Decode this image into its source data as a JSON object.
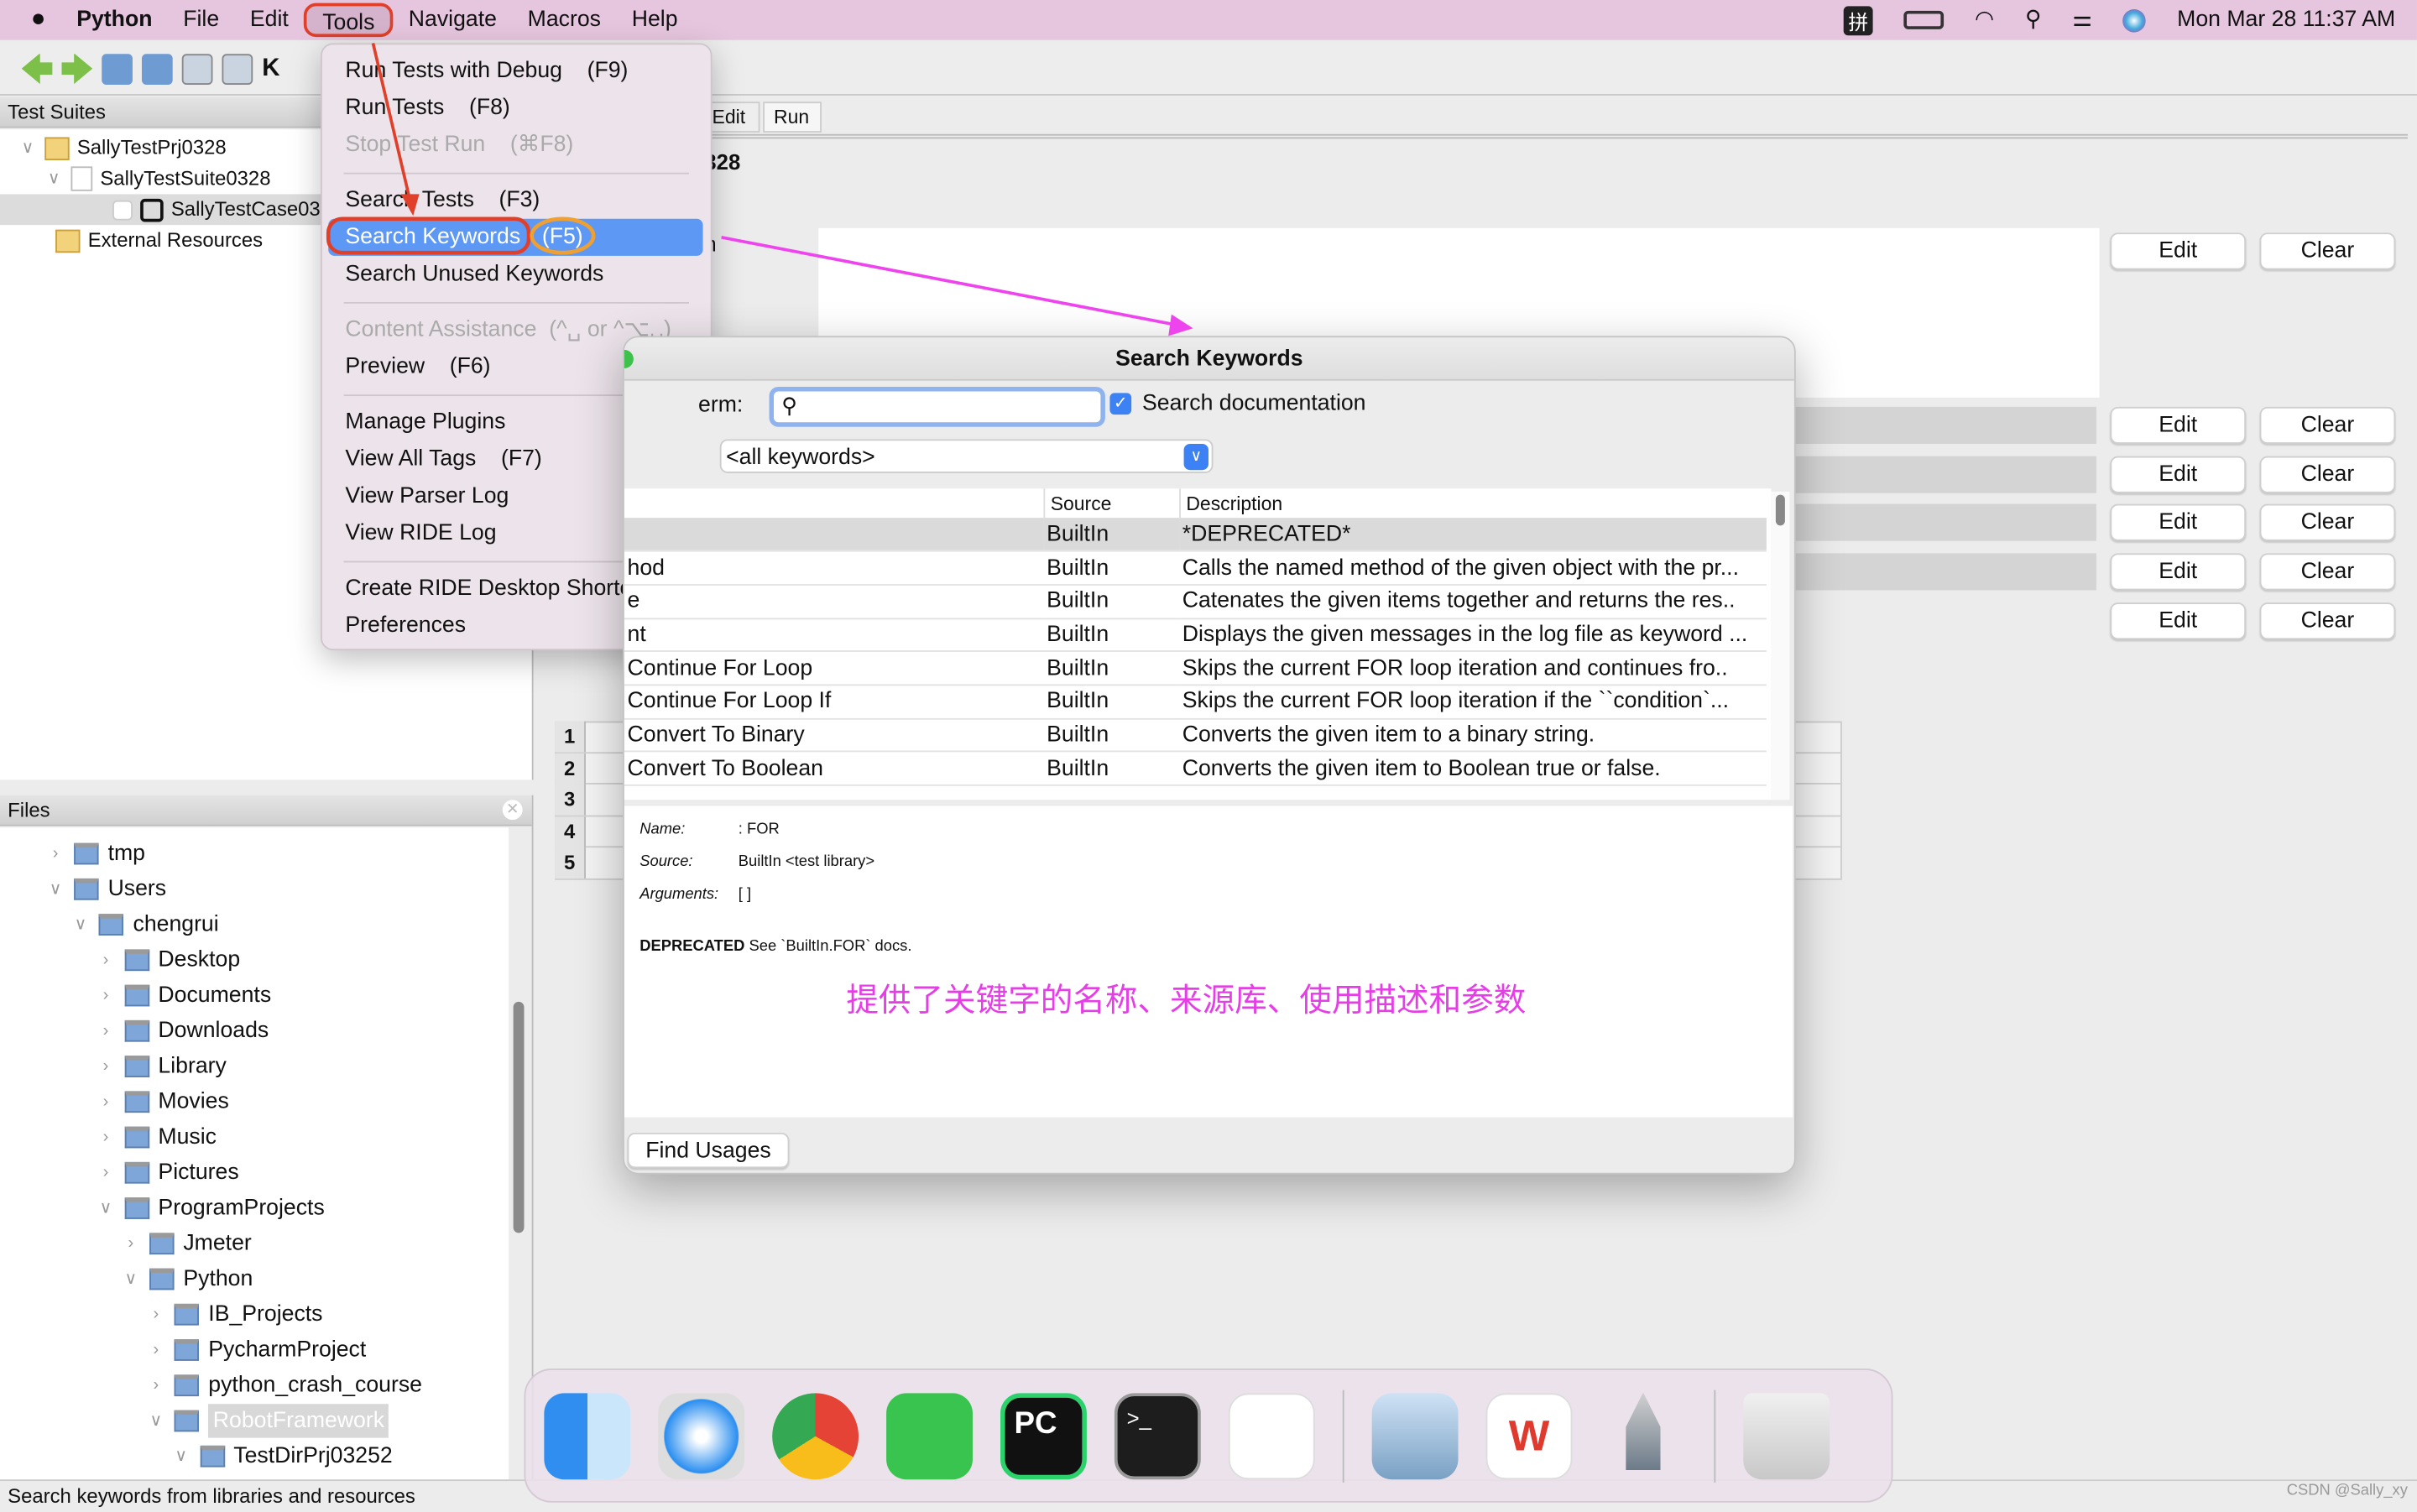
{
  "menubar": {
    "app": "Python",
    "items": [
      "File",
      "Edit",
      "Tools",
      "Navigate",
      "Macros",
      "Help"
    ],
    "input_method": "拼",
    "datetime": "Mon Mar 28  11:37 AM"
  },
  "tools_menu": {
    "items": [
      {
        "label": "Run Tests with Debug    (F9)",
        "disabled": false
      },
      {
        "label": "Run Tests    (F8)",
        "disabled": false
      },
      {
        "label": "Stop Test Run    (⌘F8)",
        "disabled": true
      },
      {
        "sep": true
      },
      {
        "label": "Search Tests    (F3)",
        "disabled": false
      },
      {
        "label": "Search Keywords",
        "shortcut": "(F5)",
        "highlighted": true
      },
      {
        "label": "Search Unused Keywords",
        "disabled": false
      },
      {
        "sep": true
      },
      {
        "label": "Content Assistance  (^␣ or ^⌥␣)",
        "disabled": true
      },
      {
        "label": "Preview    (F6)",
        "disabled": false
      },
      {
        "sep": true
      },
      {
        "label": "Manage Plugins",
        "disabled": false
      },
      {
        "label": "View All Tags    (F7)",
        "disabled": false
      },
      {
        "label": "View Parser Log",
        "disabled": false
      },
      {
        "label": "View RIDE Log",
        "disabled": false
      },
      {
        "sep": true
      },
      {
        "label": "Create RIDE Desktop Shortcut",
        "disabled": false
      },
      {
        "label": "Preferences",
        "disabled": false
      }
    ]
  },
  "test_suites": {
    "title": "Test Suites",
    "items": [
      "SallyTestPrj0328",
      "SallyTestSuite0328",
      "SallyTestCase03",
      "External Resources"
    ]
  },
  "files": {
    "title": "Files",
    "items": [
      {
        "label": "tmp",
        "level": 0,
        "open": false
      },
      {
        "label": "Users",
        "level": 0,
        "open": true
      },
      {
        "label": "chengrui",
        "level": 1,
        "open": true
      },
      {
        "label": "Desktop",
        "level": 2,
        "open": false
      },
      {
        "label": "Documents",
        "level": 2,
        "open": false
      },
      {
        "label": "Downloads",
        "level": 2,
        "open": false
      },
      {
        "label": "Library",
        "level": 2,
        "open": false
      },
      {
        "label": "Movies",
        "level": 2,
        "open": false
      },
      {
        "label": "Music",
        "level": 2,
        "open": false
      },
      {
        "label": "Pictures",
        "level": 2,
        "open": false
      },
      {
        "label": "ProgramProjects",
        "level": 2,
        "open": true
      },
      {
        "label": "Jmeter",
        "level": 3,
        "open": false
      },
      {
        "label": "Python",
        "level": 3,
        "open": true
      },
      {
        "label": "IB_Projects",
        "level": 4,
        "open": false
      },
      {
        "label": "PycharmProject",
        "level": 4,
        "open": false
      },
      {
        "label": "python_crash_course",
        "level": 4,
        "open": false
      },
      {
        "label": "RobotFramework",
        "level": 4,
        "open": true,
        "selected": true
      },
      {
        "label": "TestDirPrj03252",
        "level": 5,
        "open": true
      }
    ]
  },
  "editor": {
    "tabs": [
      "Edit",
      "Run"
    ],
    "title_fragment": "328",
    "label_fragment": "n",
    "edit_label": "Edit",
    "clear_label": "Clear",
    "grid_rows": [
      "1",
      "2",
      "3",
      "4",
      "5"
    ]
  },
  "dialog": {
    "title": "Search Keywords",
    "term_label": "erm:",
    "search_value": "",
    "search_doc_label": "Search documentation",
    "search_doc_checked": true,
    "source_select": "<all keywords>",
    "columns": [
      "",
      "Source",
      "Description"
    ],
    "rows": [
      [
        "",
        "BuiltIn",
        "*DEPRECATED*"
      ],
      [
        "hod",
        "BuiltIn",
        "Calls the named method of the given object with the pr..."
      ],
      [
        "e",
        "BuiltIn",
        "Catenates the given items together and returns the res.."
      ],
      [
        "nt",
        "BuiltIn",
        "Displays the given messages in the log file as keyword ..."
      ],
      [
        "Continue For Loop",
        "BuiltIn",
        "Skips the current FOR loop iteration and continues fro.."
      ],
      [
        "Continue For Loop If",
        "BuiltIn",
        "Skips the current FOR loop iteration if the ``condition`..."
      ],
      [
        "Convert To Binary",
        "BuiltIn",
        "Converts the given item to a binary string."
      ],
      [
        "Convert To Boolean",
        "BuiltIn",
        "Converts the given item to Boolean true or false."
      ]
    ],
    "details": {
      "name_label": "Name:",
      "name": ": FOR",
      "source_label": "Source:",
      "source": "BuiltIn <test library>",
      "args_label": "Arguments:",
      "args": "[ ]",
      "doc_bold": "DEPRECATED",
      "doc": " See `BuiltIn.FOR` docs."
    },
    "annotation": "提供了关键字的名称、来源库、使用描述和参数",
    "find_usages": "Find Usages"
  },
  "status_bar": "Search keywords from libraries and resources",
  "watermark": "CSDN @Sally_xy",
  "colors": {
    "menubar": "#e6c6de",
    "highlight": "#5e98f5",
    "annotation": "#e63ee6",
    "callout_red": "#e0402a",
    "callout_orange": "#f0a030"
  }
}
